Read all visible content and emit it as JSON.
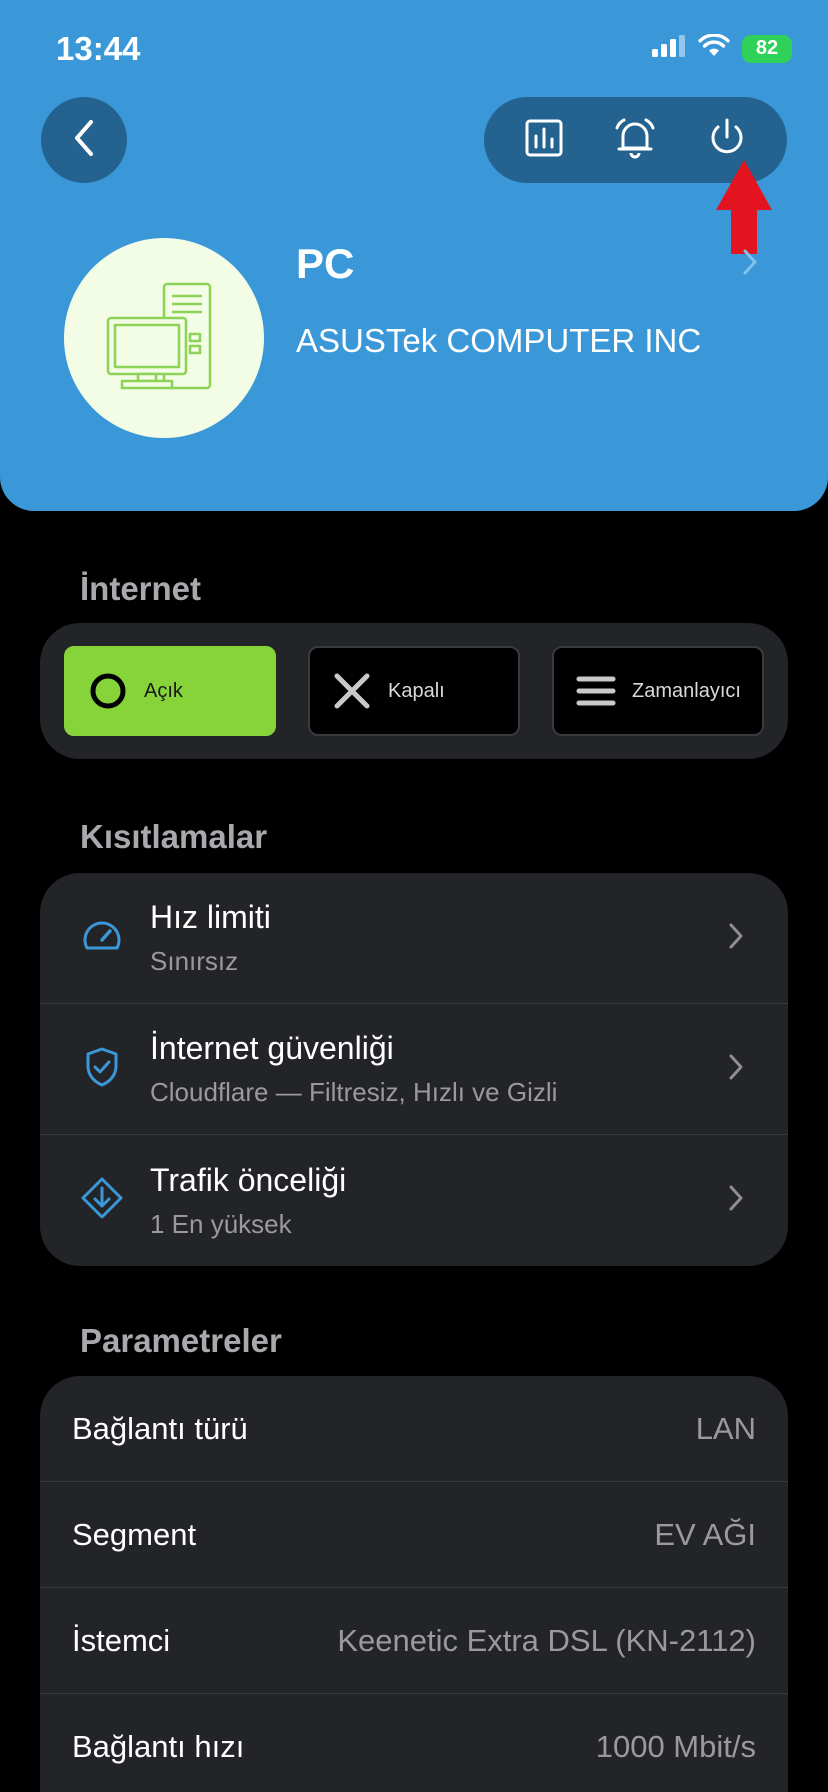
{
  "status_bar": {
    "time": "13:44",
    "battery": "82"
  },
  "device": {
    "name": "PC",
    "vendor": "ASUSTek COMPUTER INC"
  },
  "internet": {
    "section_title": "İnternet",
    "options": [
      {
        "label": "Açık",
        "icon": "circle-icon",
        "active": true
      },
      {
        "label": "Kapalı",
        "icon": "x-icon",
        "active": false
      },
      {
        "label": "Zamanlayıcı",
        "icon": "menu-icon",
        "active": false
      }
    ]
  },
  "restrictions": {
    "section_title": "Kısıtlamalar",
    "items": [
      {
        "title": "Hız limiti",
        "subtitle": "Sınırsız",
        "icon": "speedometer-icon"
      },
      {
        "title": "İnternet güvenliği",
        "subtitle": "Cloudflare — Filtresiz, Hızlı ve Gizli",
        "icon": "shield-icon"
      },
      {
        "title": "Trafik önceliği",
        "subtitle": "1 En yüksek",
        "icon": "priority-icon"
      }
    ]
  },
  "parameters": {
    "section_title": "Parametreler",
    "rows": [
      {
        "label": "Bağlantı türü",
        "value": "LAN"
      },
      {
        "label": "Segment",
        "value": "EV AĞI"
      },
      {
        "label": "İstemci",
        "value": "Keenetic Extra DSL (KN-2112)"
      },
      {
        "label": "Bağlantı hızı",
        "value": "1000 Mbit/s"
      }
    ]
  },
  "colors": {
    "header_bg": "#3b98d8",
    "accent_green": "#86d33a",
    "icon_blue": "#3b98d8",
    "annotation_arrow": "#e3141f"
  }
}
